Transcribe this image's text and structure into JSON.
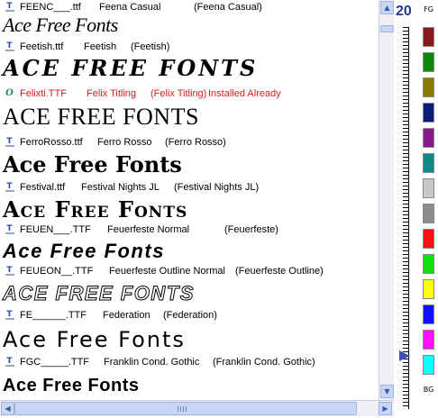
{
  "rows": [
    {
      "file": "FEENC___.ttf",
      "name": "Feena Casual",
      "alias": "(Feena Casual)",
      "status": "",
      "icon": "truetype-icon"
    },
    {
      "file": "Feetish.ttf",
      "name": "Feetish",
      "alias": "(Feetish)",
      "status": "",
      "icon": "truetype-icon"
    },
    {
      "file": "Felixti.TTF",
      "name": "Felix Titling",
      "alias": "(Felix Titling)",
      "status": "Installed Already",
      "icon": "opentype-icon"
    },
    {
      "file": "FerroRosso.ttf",
      "name": "Ferro Rosso",
      "alias": "(Ferro Rosso)",
      "status": "",
      "icon": "truetype-icon"
    },
    {
      "file": "Festival.ttf",
      "name": "Festival Nights JL",
      "alias": "(Festival Nights JL)",
      "status": "",
      "icon": "truetype-icon"
    },
    {
      "file": "FEUEN___.TTF",
      "name": "Feuerfeste Normal",
      "alias": "(Feuerfeste)",
      "status": "",
      "icon": "truetype-icon"
    },
    {
      "file": "FEUEON__.TTF",
      "name": "Feuerfeste Outline Normal",
      "alias": "(Feuerfeste Outline)",
      "status": "",
      "icon": "truetype-icon"
    },
    {
      "file": "FE______.TTF",
      "name": "Federation",
      "alias": "(Federation)",
      "status": "",
      "icon": "truetype-icon"
    },
    {
      "file": "FGC_____.TTF",
      "name": "Franklin Cond. Gothic",
      "alias": "(Franklin Cond. Gothic)",
      "status": "",
      "icon": "truetype-icon"
    }
  ],
  "samples": [
    "Ace Free Fonts",
    "Ace Free Fonts",
    "ACE FREE FONTS",
    "Ace Free Fonts",
    "Ace Free Fonts",
    "Ace Free Fonts",
    "ACE FREE FONTS",
    "Ace Free Fonts",
    "Ace Free Fonts"
  ],
  "panel": {
    "size": "20",
    "fg_label": "FG",
    "bg_label": "BG",
    "size_level_fraction": 0.86,
    "swatch_colors": [
      "#8b1a1a",
      "#0a8a0a",
      "#8c7a00",
      "#0b1b7a",
      "#8a1a8a",
      "#0a8a8a",
      "#c8c8c8",
      "#8c8c8c",
      "#ff1010",
      "#10e010",
      "#ffff10",
      "#1010ff",
      "#ff10ff",
      "#10ffff"
    ]
  },
  "colors": {
    "installed_text": "#d42020",
    "scroll_accent": "#c7d6f5",
    "size_text": "#223a8a"
  }
}
